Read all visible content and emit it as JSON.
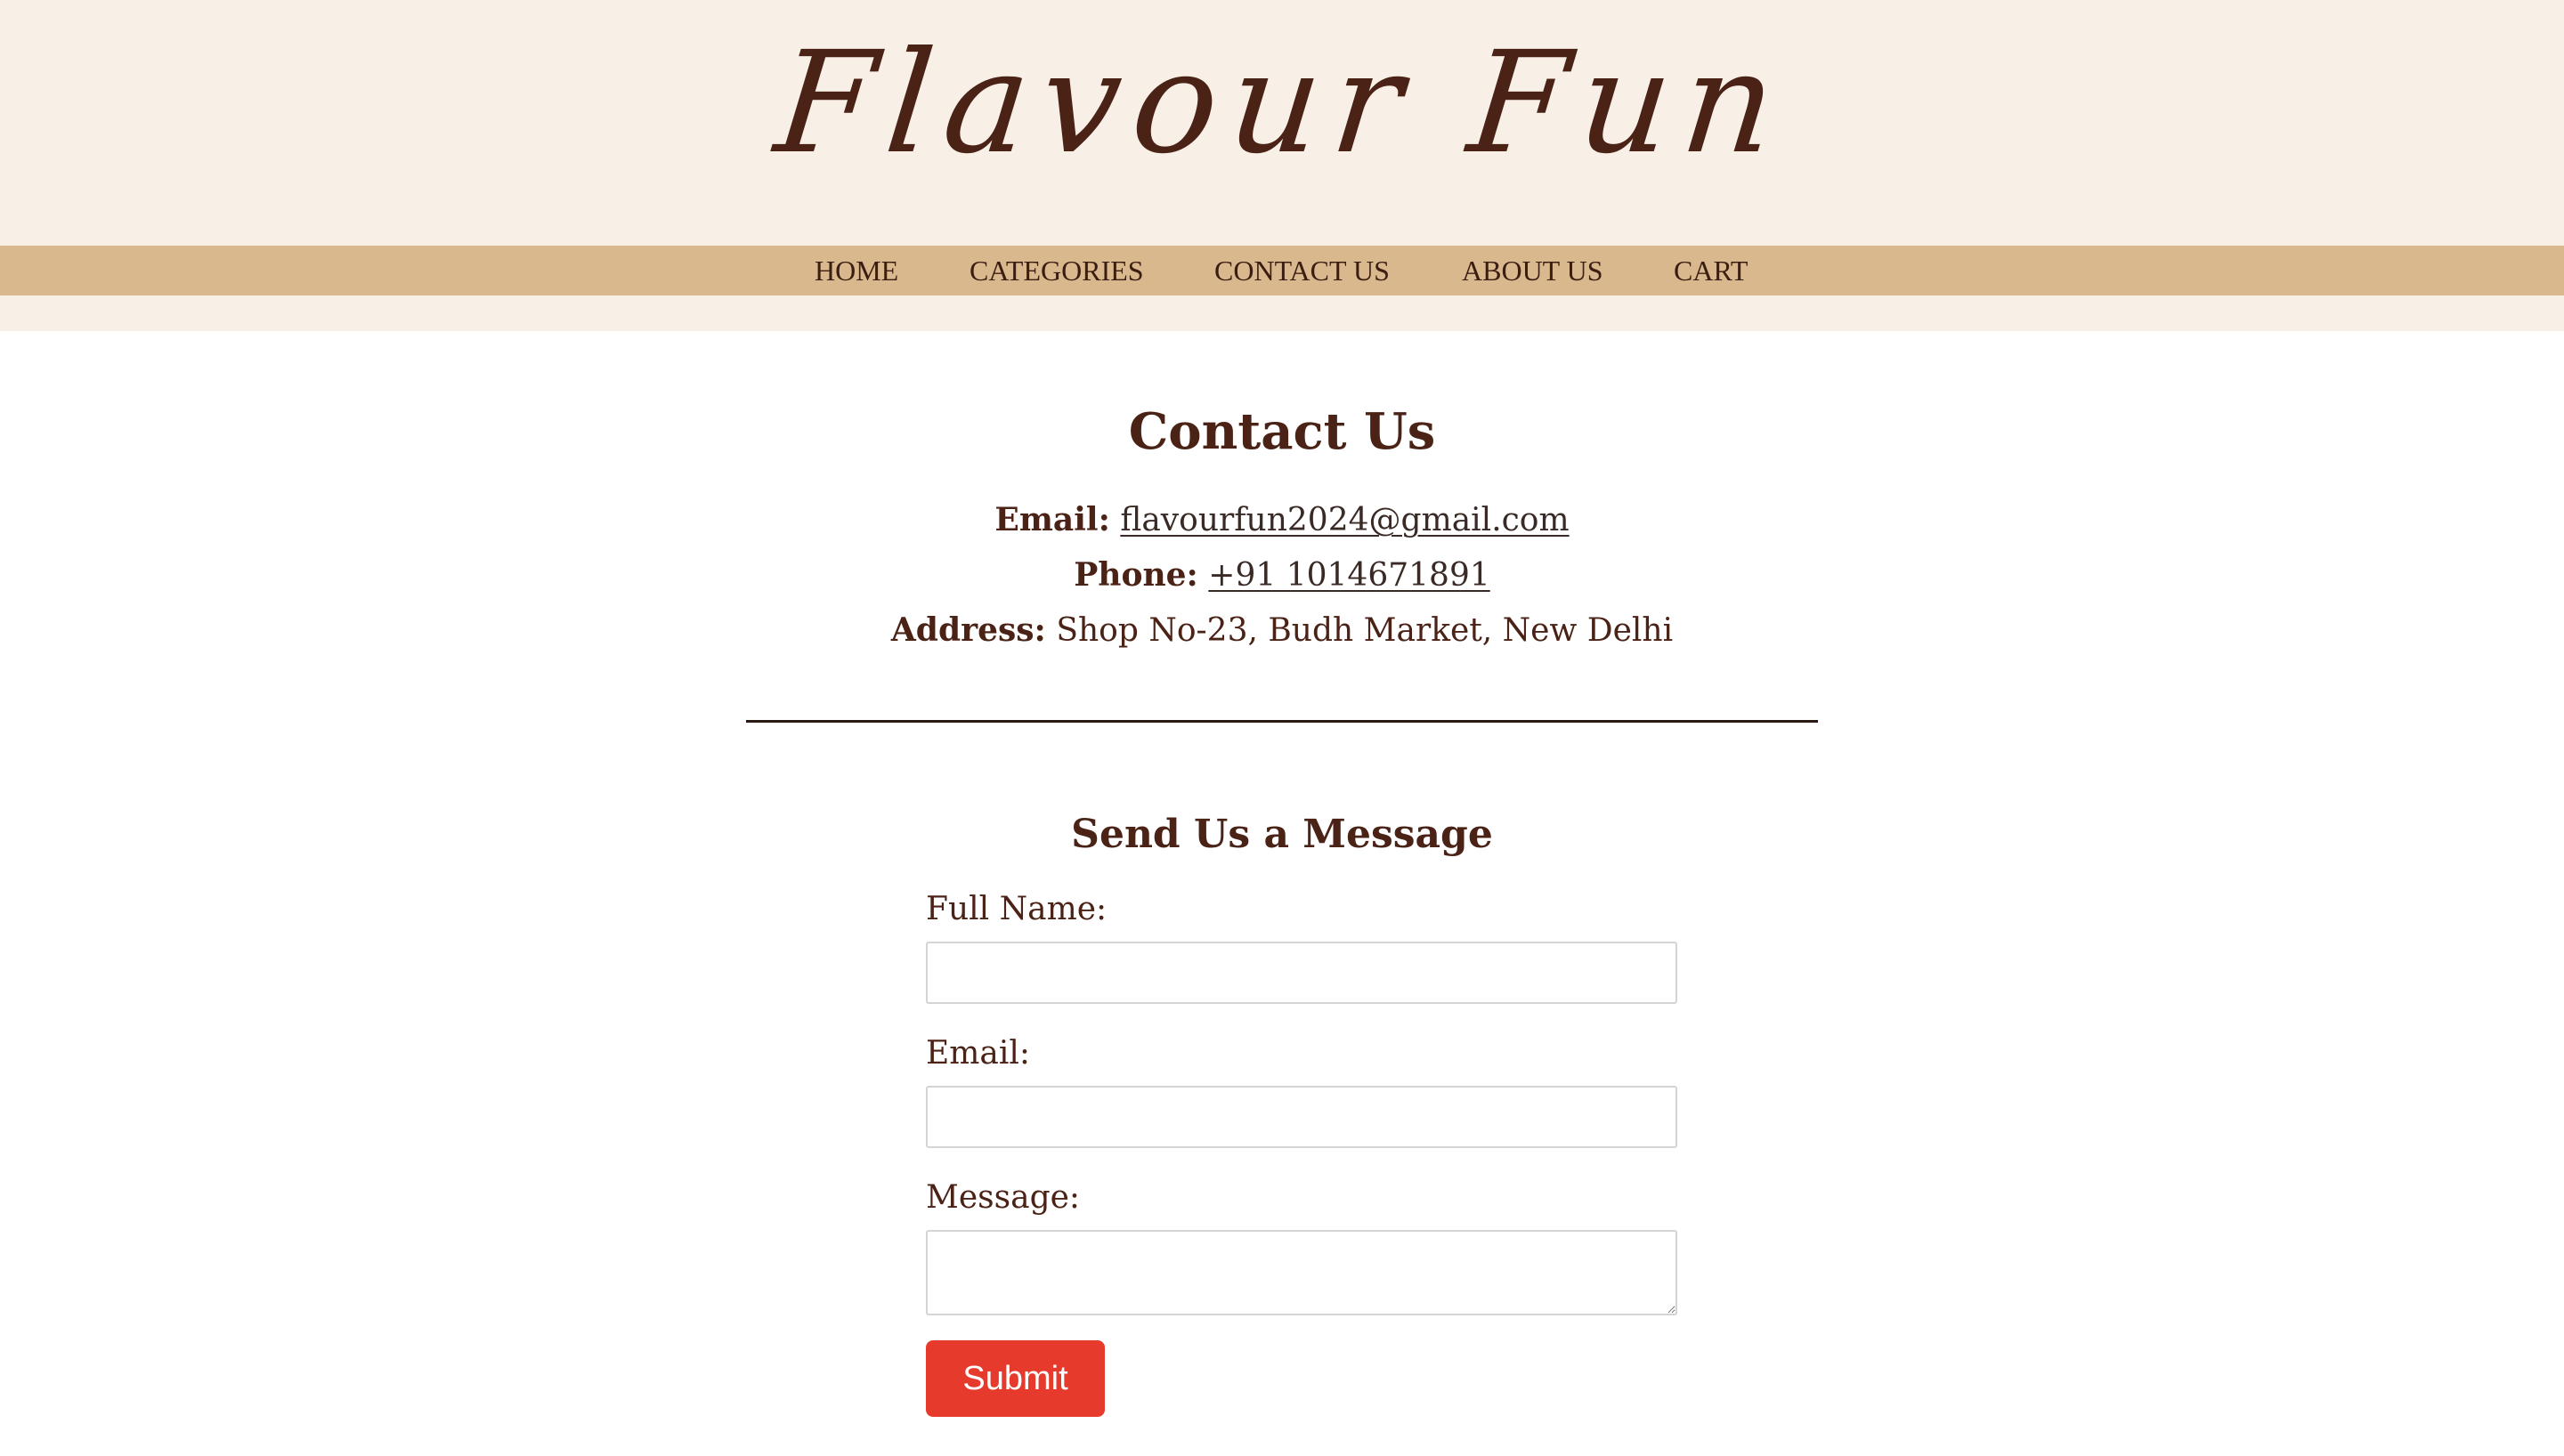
{
  "site": {
    "logo": "Flavour Fun"
  },
  "nav": {
    "items": [
      {
        "label": "HOME"
      },
      {
        "label": "CATEGORIES"
      },
      {
        "label": "CONTACT US"
      },
      {
        "label": "ABOUT US"
      },
      {
        "label": "CART"
      }
    ]
  },
  "contact": {
    "title": "Contact Us",
    "email_label": "Email:",
    "email_value": "flavourfun2024@gmail.com",
    "phone_label": "Phone:",
    "phone_value": "+91 1014671891",
    "address_label": "Address:",
    "address_value": "Shop No-23, Budh Market, New Delhi"
  },
  "form": {
    "title": "Send Us a Message",
    "full_name_label": "Full Name:",
    "full_name_value": "",
    "email_label": "Email:",
    "email_value": "",
    "message_label": "Message:",
    "message_value": "",
    "submit_label": "Submit"
  },
  "colors": {
    "header_bg": "#f8f0e6",
    "nav_bg": "#d8b88c",
    "text_brown": "#4a2216",
    "submit_bg": "#e53a2c"
  }
}
